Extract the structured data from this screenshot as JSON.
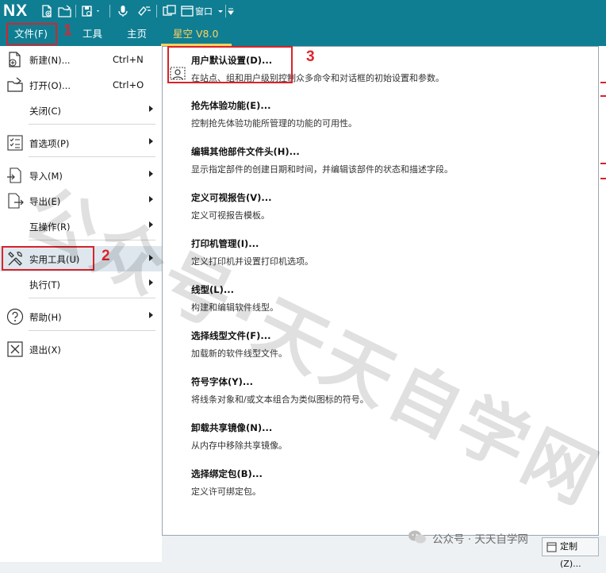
{
  "app": {
    "logo": "NX",
    "window_menu_label": "窗口"
  },
  "ribbon": {
    "tabs": [
      {
        "label": "文件(F)"
      },
      {
        "label": "工具"
      },
      {
        "label": "主页"
      },
      {
        "label": "星空 V8.0"
      }
    ]
  },
  "file_menu": {
    "items": [
      {
        "label": "新建(N)...",
        "shortcut": "Ctrl+N",
        "icon": "new-file-icon"
      },
      {
        "label": "打开(O)...",
        "shortcut": "Ctrl+O",
        "icon": "open-folder-icon"
      },
      {
        "label": "关闭(C)",
        "icon": ""
      },
      {
        "label": "首选项(P)",
        "icon": "preferences-list-icon"
      },
      {
        "label": "导入(M)",
        "icon": "import-icon"
      },
      {
        "label": "导出(E)",
        "icon": "export-icon"
      },
      {
        "label": "互操作(R)",
        "icon": ""
      },
      {
        "label": "实用工具(U)",
        "icon": "tools-icon"
      },
      {
        "label": "执行(T)",
        "icon": ""
      },
      {
        "label": "帮助(H)",
        "icon": "help-icon"
      },
      {
        "label": "退出(X)",
        "icon": "exit-icon"
      }
    ]
  },
  "utilities_submenu": {
    "items": [
      {
        "title": "用户默认设置(D)...",
        "desc": "在站点、组和用户级别控制众多命令和对话框的初始设置和参数。",
        "icon": "user-defaults-icon"
      },
      {
        "title": "抢先体验功能(E)...",
        "desc": "控制抢先体验功能所管理的功能的可用性。"
      },
      {
        "title": "编辑其他部件文件头(H)...",
        "desc": "显示指定部件的创建日期和时间，并编辑该部件的状态和描述字段。"
      },
      {
        "title": "定义可视报告(V)...",
        "desc": "定义可视报告模板。"
      },
      {
        "title": "打印机管理(I)...",
        "desc": "定义打印机并设置打印机选项。"
      },
      {
        "title": "线型(L)...",
        "desc": "构建和编辑软件线型。"
      },
      {
        "title": "选择线型文件(F)...",
        "desc": "加载新的软件线型文件。"
      },
      {
        "title": "符号字体(Y)...",
        "desc": "将线条对象和/或文本组合为类似图标的符号。"
      },
      {
        "title": "卸载共享镜像(N)...",
        "desc": "从内存中移除共享镜像。"
      },
      {
        "title": "选择绑定包(B)...",
        "desc": "定义许可绑定包。"
      }
    ]
  },
  "annotations": {
    "step1": "1",
    "step2": "2",
    "step3": "3"
  },
  "customize_button": {
    "label": "定制(Z)..."
  },
  "watermark": {
    "text": "公众号·天天自学网",
    "wechat_label": "公众号 · 天天自学网"
  },
  "colors": {
    "titlebar": "#0f7e93",
    "accent_tab": "#ffd25e",
    "highlight_red": "#d8232a"
  }
}
